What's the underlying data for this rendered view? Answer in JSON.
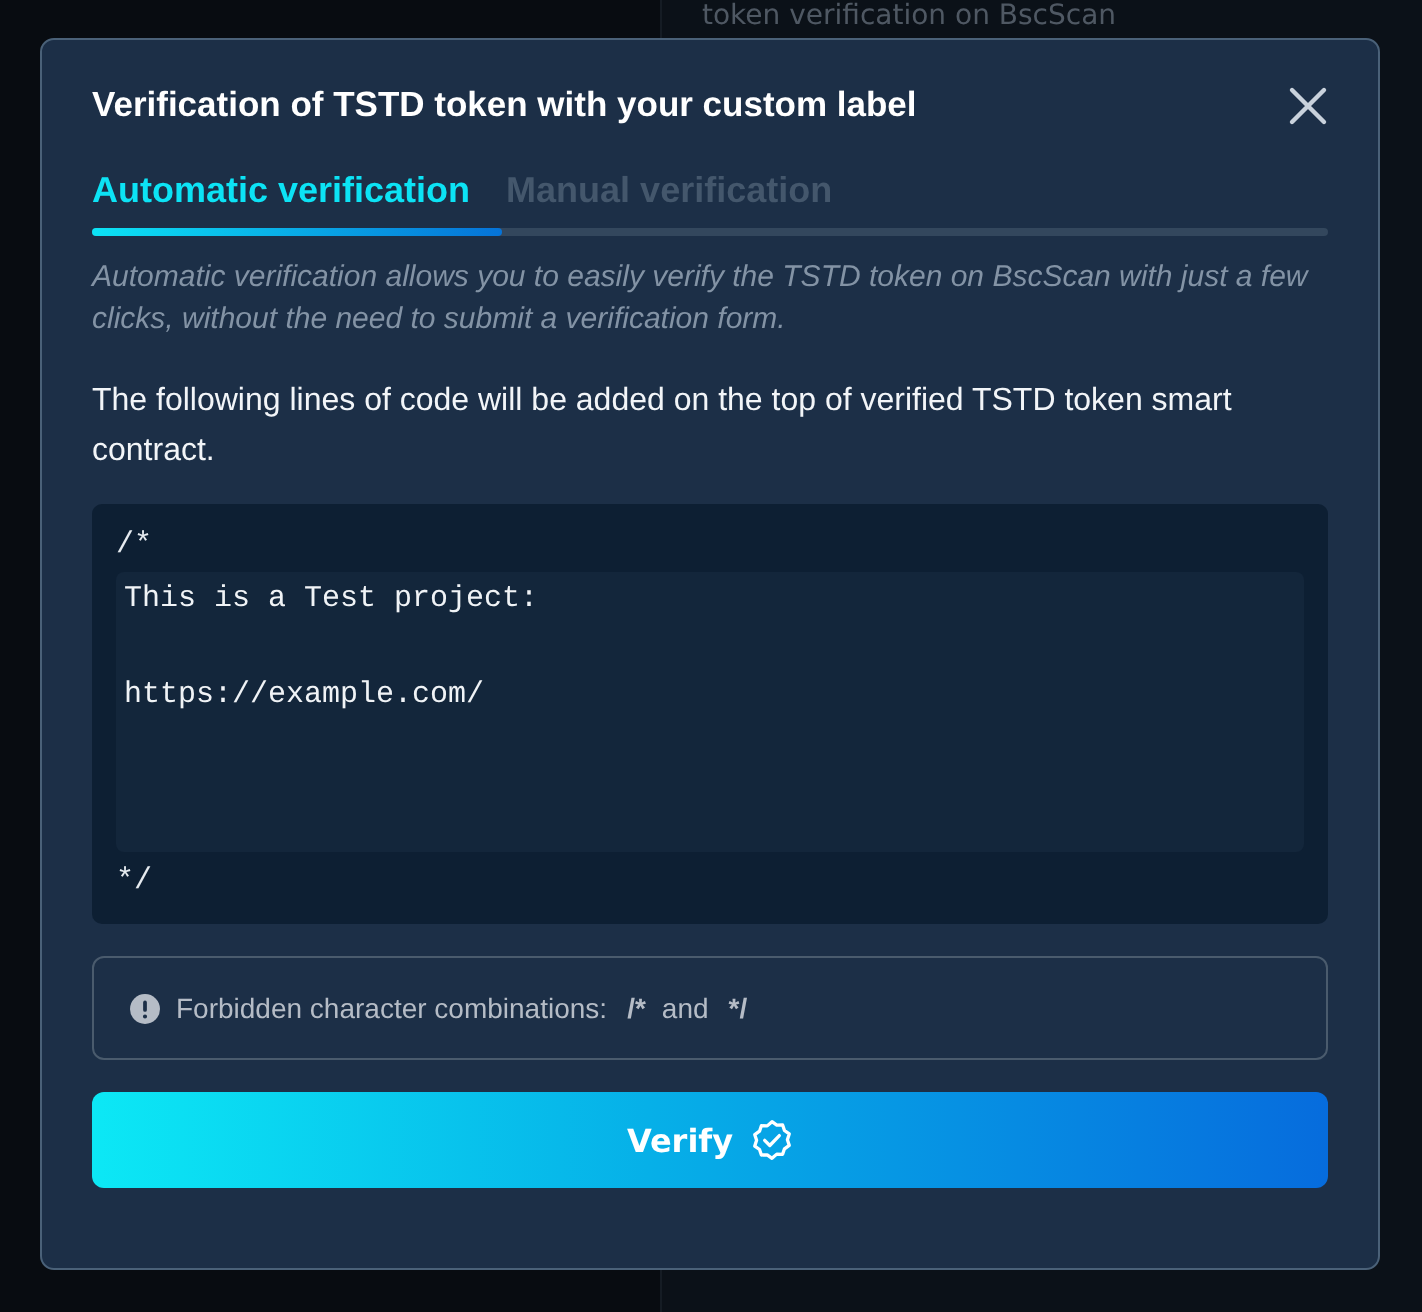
{
  "background": {
    "heading": "token verification on BscScan"
  },
  "dialog": {
    "title": "Verification of TSTD token with your custom label",
    "tabs": [
      {
        "label": "Automatic verification",
        "selected": true
      },
      {
        "label": "Manual verification",
        "selected": false
      }
    ],
    "description": "Automatic verification allows you to easily verify the TSTD token on BscScan with just a few clicks, without the need to submit a verification form.",
    "intro": "The following lines of code will be added on the top of verified TSTD token smart contract.",
    "code": {
      "open_comment": "/*",
      "value": "This is a Test project:\n\nhttps://example.com/",
      "close_comment": "*/"
    },
    "notice": {
      "label": "Forbidden character combinations:",
      "first": "/*",
      "joiner": "and",
      "second": "*/"
    },
    "verify_button": "Verify"
  }
}
